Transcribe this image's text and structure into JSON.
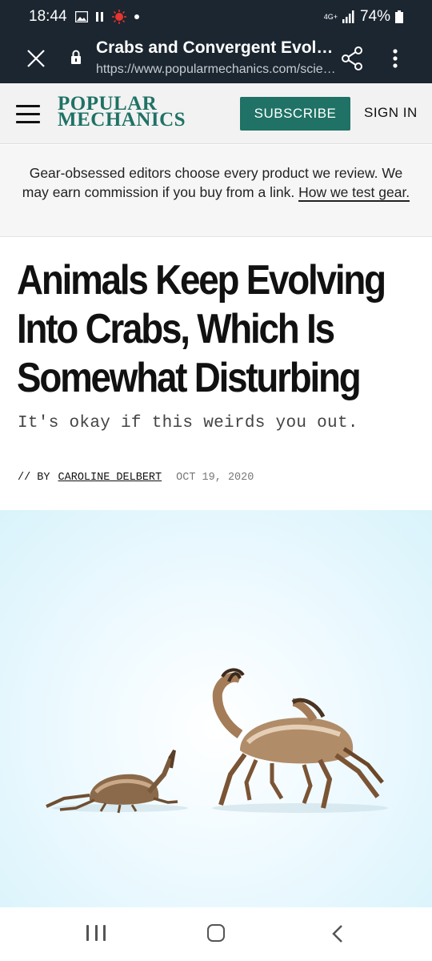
{
  "status_bar": {
    "time": "18:44",
    "network": "4G+",
    "battery": "74%"
  },
  "browser": {
    "title": "Crabs and Convergent Evoluti…",
    "url": "https://www.popularmechanics.com/scie…",
    "icons": [
      "close-icon",
      "lock-icon",
      "share-icon",
      "more-vert-icon"
    ]
  },
  "header": {
    "logo_line1": "POPULAR",
    "logo_line2": "MECHANICS",
    "subscribe_label": "SUBSCRIBE",
    "signin_label": "SIGN IN",
    "brand_color": "#1f7265"
  },
  "disclosure": {
    "text": "Gear-obsessed editors choose every product we review. We may earn commission if you buy from a link.",
    "link": "How we test gear."
  },
  "article": {
    "headline": "Animals Keep Evolving Into Crabs, Which Is Somewhat Disturbing",
    "dek": "It's okay if this weirds you out.",
    "byline_prefix": "// BY",
    "author": "CAROLINE DELBERT",
    "date": "OCT 19, 2020"
  },
  "nav": {
    "icons": [
      "recents-icon",
      "home-icon",
      "back-icon"
    ]
  }
}
